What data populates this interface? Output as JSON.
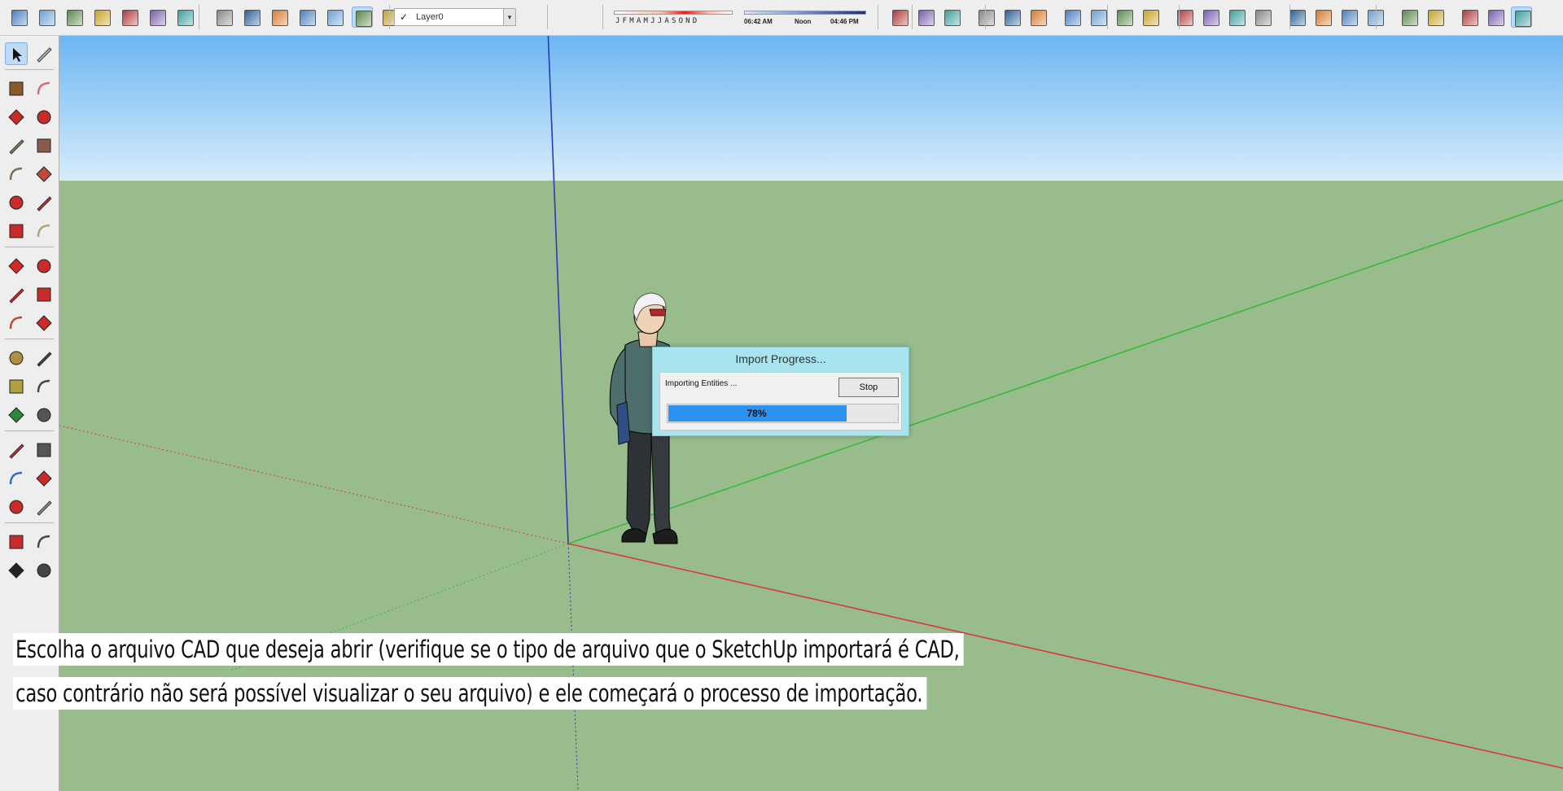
{
  "toolbar": {
    "layer_selector": {
      "checked_mark": "✓",
      "value": "Layer0"
    },
    "shadow_months": {
      "labels": "JFMAMJJASOND"
    },
    "shadow_time": {
      "start": "06:42 AM",
      "mid": "Noon",
      "end": "04:46 PM"
    },
    "icons": [
      "components-icon",
      "materials-icon",
      "iso-view-icon",
      "top-view-icon",
      "front-view-icon",
      "right-view-icon",
      "back-view-icon",
      "xray-icon",
      "back-edges-icon",
      "wireframe-icon",
      "hidden-line-icon",
      "shaded-icon",
      "shaded-textures-icon",
      "monochrome-icon",
      "layer-manager-icon",
      "shadows-icon",
      "fog-icon",
      "section-plane-icon",
      "display-section-icon",
      "display-cuts-icon",
      "sandbox-from-contours-icon",
      "sandbox-from-scratch-icon",
      "smoove-icon",
      "stamp-icon",
      "drape-icon",
      "flip-edge-icon",
      "add-location-icon",
      "toggle-terrain-icon",
      "photo-textures-icon",
      "3d-warehouse-icon",
      "share-model-icon",
      "share-component-icon",
      "extension-warehouse-icon",
      "position-camera-icon",
      "look-around-icon",
      "walk-icon",
      "style-builder-icon",
      "layout-icon",
      "scenes-icon",
      "dynamic-components-icon",
      "component-options-icon",
      "warning-icon"
    ]
  },
  "left_tools": [
    "select-icon",
    "make-component-icon",
    "paint-bucket-icon",
    "eraser-icon",
    "line-icon",
    "freehand-icon",
    "rectangle-icon",
    "rotated-rectangle-icon",
    "circle-icon",
    "polygon-icon",
    "arc-icon",
    "two-point-arc-icon",
    "three-point-arc-icon",
    "pie-icon",
    "move-icon",
    "push-pull-icon",
    "rotate-icon",
    "follow-me-icon",
    "scale-icon",
    "offset-icon",
    "tape-measure-icon",
    "dimensions-icon",
    "protractor-icon",
    "text-icon",
    "axes-icon",
    "3d-text-icon",
    "orbit-icon",
    "pan-icon",
    "zoom-icon",
    "zoom-window-icon",
    "zoom-extents-icon",
    "previous-view-icon",
    "position-camera-icon",
    "look-around-icon",
    "walk-icon",
    "section-plane-icon"
  ],
  "dialog": {
    "title": "Import Progress...",
    "status": "Importing Entities ...",
    "stop_label": "Stop",
    "progress": 0.78,
    "progress_label": "78%"
  },
  "caption": {
    "line1": "Escolha o arquivo CAD que deseja abrir (verifique se o tipo de arquivo que o SketchUp importará é CAD,",
    "line2": "caso contrário não será possível visualizar o seu arquivo) e ele começará o processo de importação."
  },
  "colors": {
    "ground": "#98bc8b",
    "sky": "#6db6f2",
    "axis_red": "#d83a3a",
    "axis_green": "#3ab83a",
    "axis_blue": "#2a3ab8",
    "dialog_frame": "#a8e4ee",
    "progress_fill": "#2c92f0"
  }
}
